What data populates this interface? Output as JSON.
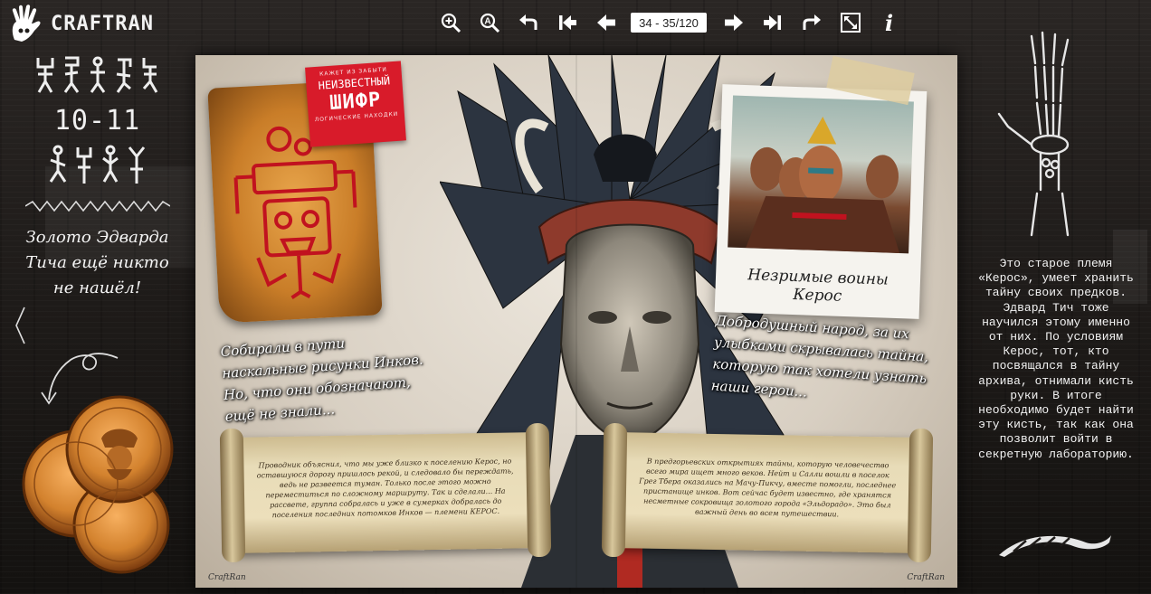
{
  "brand": {
    "name": "CRAFTRAN"
  },
  "toolbar": {
    "page_counter": "34 - 35/120",
    "info_label": "i",
    "icons": [
      "zoom-in-icon",
      "zoom-auto-icon",
      "undo-icon",
      "first-page-icon",
      "prev-page-icon",
      "next-page-icon",
      "last-page-icon",
      "redo-icon",
      "fullscreen-icon",
      "info-icon"
    ]
  },
  "left_panel": {
    "age": "10-11",
    "headline": "Золото Эдварда Тича ещё никто не нашёл!"
  },
  "book": {
    "stamp": {
      "top_line": "КАЖЕТ ИЗ ЗАБЫТИ",
      "line1": "НЕИЗВЕСТНЫЙ",
      "line2": "ШИФР",
      "bottom_line": "ЛОГИЧЕСКИЕ НАХОДКИ"
    },
    "polaroid_caption": "Незримые воины Керос",
    "caption_left": "Собирали в пути наскальные рисунки Инков. Но, что они обозначают, ещё не знали...",
    "caption_right": "Добродушный народ, за их улыбками скрывалась тайна, которую так хотели узнать наши герои...",
    "scroll_left": "Проводник объяснил, что мы уже близко к поселению Керос, но оставшуюся дорогу пришлось рекой, и следовало бы переждать, ведь не развеется туман. Только после этого можно переместиться по сложному маршруту. Так и сделали... На рассвете, группа собралась и уже в сумерках добралась до поселения последних потомков Инков — племени КЕРОС.",
    "scroll_right": "В предгорьевских открытиях тайны, которую человечество всего мира ищет много веков. Нейт и Салли вошли в поселок Грег Тбера оказались на Мачу-Пикчу, вместе помогли, последнее пристанище инков. Вот сейчас будет известно, где хранятся несметные сокровища золотого города «Эльдорадо». Это был важный день во всем путешествии.",
    "watermark_left": "CraftRan",
    "watermark_right": "CraftRan"
  },
  "right_panel": {
    "text": "Это старое племя «Керос», умеет хранить тайну своих предков. Эдвард Тич тоже научился этому именно от них. По условиям Керос, тот, кто посвящался в тайну архива, отнимали кисть руки. В итоге необходимо будет найти эту кисть, так как она позволит войти в секретную лабораторию."
  },
  "colors": {
    "background": "#1f1c1a",
    "stamp_red": "#d81b2a",
    "parchment_orange": "#c97d28",
    "coin_gold": "#d3822e"
  }
}
